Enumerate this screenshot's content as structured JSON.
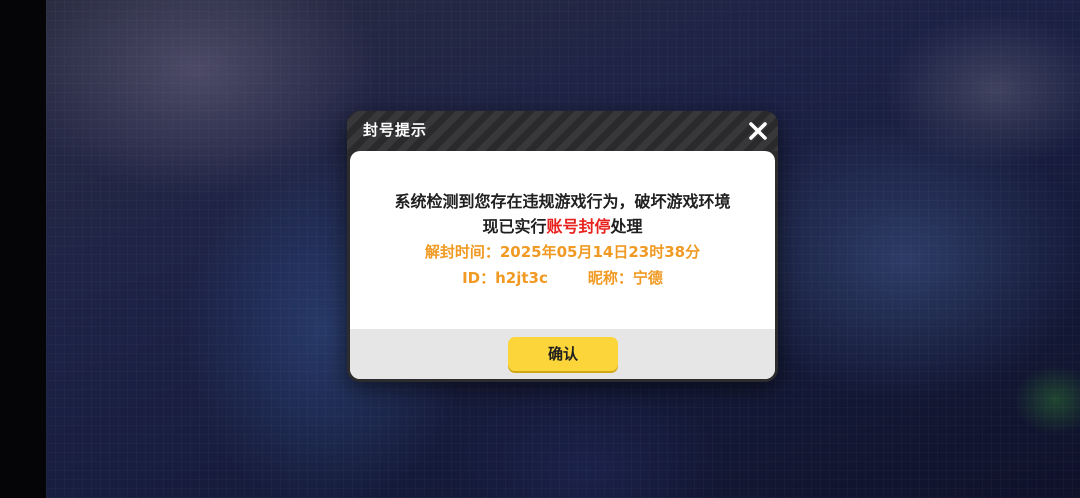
{
  "dialog": {
    "title": "封号提示",
    "close_icon": "close-icon",
    "message": {
      "line1": "系统检测到您存在违规游戏行为，破坏游戏环境",
      "line2_prefix": "现已实行",
      "line2_highlight": "账号封停",
      "line2_suffix": "处理",
      "unban_label": "解封时间：",
      "unban_time": "2025年05月14日23时38分",
      "id_label": "ID：",
      "id_value": "h2jt3c",
      "nickname_label": "昵称：",
      "nickname_value": "宁德"
    },
    "confirm_label": "确认"
  },
  "colors": {
    "highlight_red": "#e8231f",
    "info_orange": "#f09a23",
    "button_yellow": "#fbd53a"
  }
}
